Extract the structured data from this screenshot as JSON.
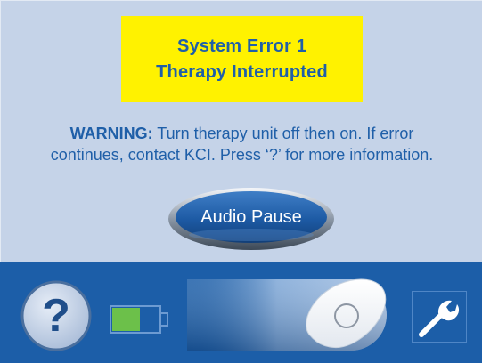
{
  "error": {
    "title_line1": "System Error 1",
    "title_line2": "Therapy Interrupted"
  },
  "warning": {
    "label": "WARNING:",
    "line1_text": " Turn therapy unit off then on. If error",
    "line2_text": "continues, contact KCI.   Press ‘?’ for more information."
  },
  "buttons": {
    "audio_pause": "Audio Pause",
    "help_label": "?"
  },
  "battery": {
    "level": 0.6
  },
  "icons": {
    "help": "question-icon",
    "battery": "battery-icon",
    "lock_slider": "slider-handle-icon",
    "settings": "wrench-icon"
  },
  "colors": {
    "background": "#c5d3e8",
    "error_banner": "#fff200",
    "text_blue": "#1f5fa8",
    "bottom_bar": "#1c5ea8",
    "battery_fill": "#6cc04a"
  }
}
